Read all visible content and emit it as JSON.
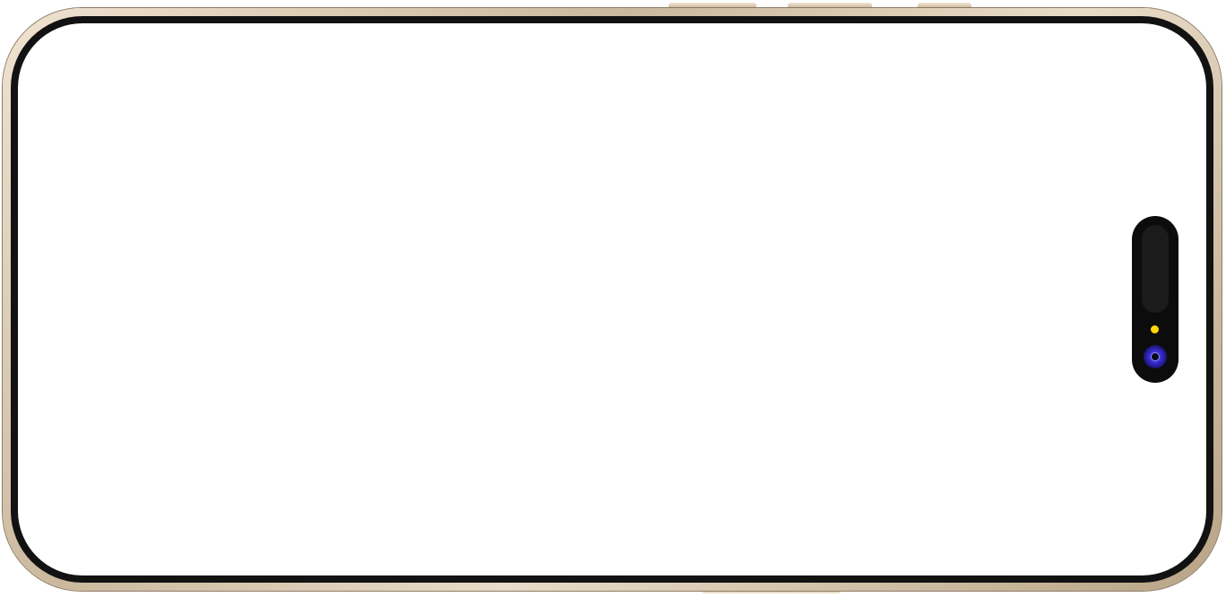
{
  "device": {
    "model": "phone-landscape",
    "frame_color": "#d7c4a9",
    "bezel_color": "#121212",
    "screen_color": "#ffffff"
  },
  "screen": {
    "content": ""
  },
  "island": {
    "indicator_color": "#ffd60a",
    "camera_color": "#3a2fd8"
  },
  "icons": {
    "camera": "front-camera-icon",
    "indicator": "privacy-indicator-icon"
  }
}
